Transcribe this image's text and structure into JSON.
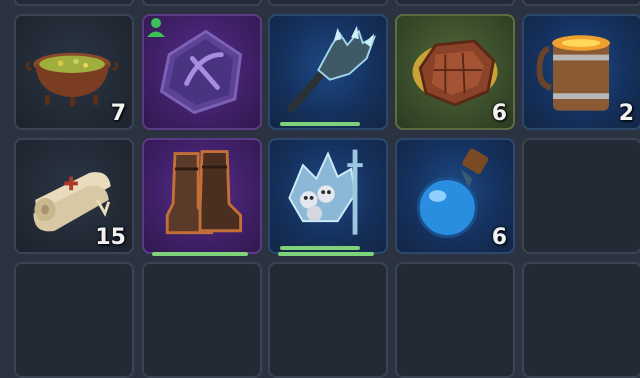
{
  "inventory": {
    "slots": [
      {
        "item": "soup-cauldron",
        "rarity": "grey",
        "count": "7"
      },
      {
        "item": "rune-stone",
        "rarity": "purple",
        "count": ""
      },
      {
        "item": "ice-mace",
        "rarity": "blue",
        "count": ""
      },
      {
        "item": "leather-patch",
        "rarity": "green",
        "count": "6"
      },
      {
        "item": "fire-mug",
        "rarity": "blue",
        "count": "2"
      },
      {
        "item": "bandage-roll",
        "rarity": "grey",
        "count": "15"
      },
      {
        "item": "leather-boots",
        "rarity": "purple",
        "count": ""
      },
      {
        "item": "ice-skull-sword",
        "rarity": "blue",
        "count": ""
      },
      {
        "item": "blue-potion",
        "rarity": "blue",
        "count": "6"
      }
    ],
    "durability": {
      "ice-mace": 0.8,
      "leather-boots": 0.8,
      "ice-skull-sword": 0.8
    }
  },
  "colors": {
    "blue_rarity": "#15315e",
    "purple_rarity": "#41216a",
    "green_rarity": "#3c4f2c",
    "durability": "#7fd17a",
    "badge": "#3fbf5a"
  }
}
